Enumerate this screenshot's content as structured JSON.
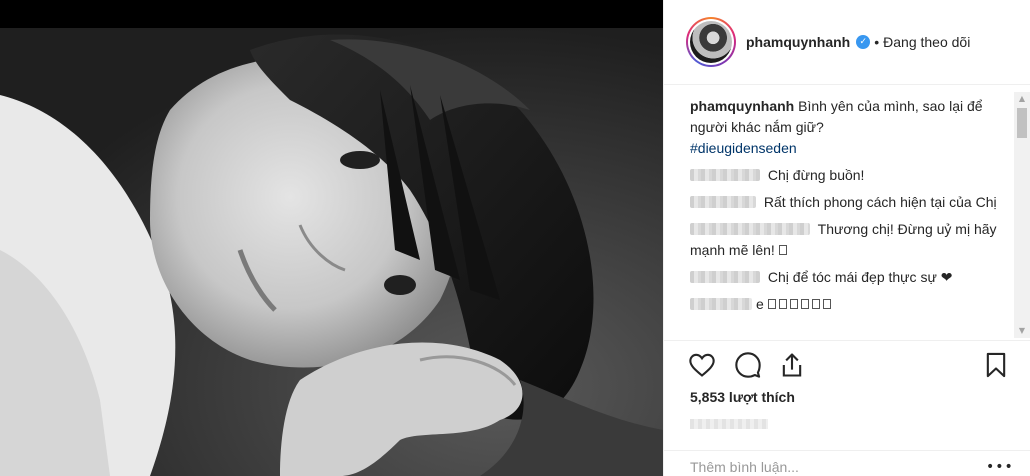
{
  "post": {
    "username": "phamquynhanh",
    "separator": "•",
    "follow_status": "Đang theo dõi",
    "verified_icon": "verified-badge-icon",
    "caption": "Bình yên của mình, sao lại để người khác nắm giữ?",
    "hashtag": "#dieugidenseden",
    "likes": "5,853 lượt thích",
    "add_comment_placeholder": "Thêm bình luận...",
    "more": "•••"
  },
  "comments": [
    {
      "text": "Chị đừng buồn!"
    },
    {
      "text": "Rất thích phong cách hiện tại của Chị"
    },
    {
      "text": "Thương chị! Đừng uỷ mị hãy mạnh mẽ lên!"
    },
    {
      "text": "Chị để tóc mái đẹp thực sự ❤"
    },
    {
      "text": "e"
    }
  ],
  "colors": {
    "verified_blue": "#3897f0",
    "hashtag": "#003569",
    "placeholder": "#999999"
  },
  "icons": [
    "heart-icon",
    "comment-icon",
    "share-icon",
    "bookmark-icon"
  ]
}
